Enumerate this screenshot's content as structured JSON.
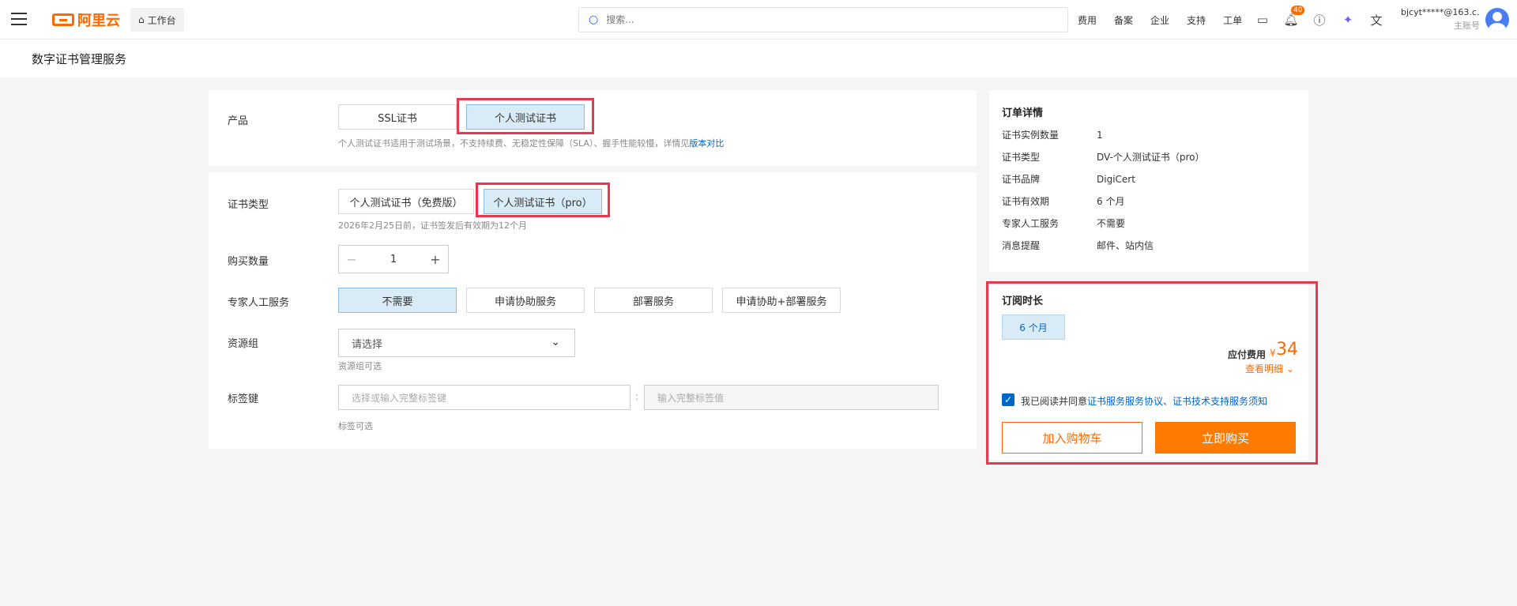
{
  "topbar": {
    "logo_text": "阿里云",
    "workbench": "工作台",
    "search_placeholder": "搜索...",
    "links": [
      "费用",
      "备案",
      "企业",
      "支持",
      "工单"
    ],
    "notification_count": "40",
    "account": "bjcyt*****@163.c...",
    "account_role": "主账号"
  },
  "page_title": "数字证书管理服务",
  "product": {
    "label": "产品",
    "options": [
      "SSL证书",
      "个人测试证书"
    ],
    "hint": "个人测试证书适用于测试场景，不支持续费、无稳定性保障（SLA）、握手性能较慢，详情见",
    "hint_link": "版本对比"
  },
  "config": {
    "cert_type_label": "证书类型",
    "cert_type_options": [
      "个人测试证书（免费版）",
      "个人测试证书（pro）"
    ],
    "cert_type_hint": "2026年2月25日前，证书签发后有效期为12个月",
    "quantity_label": "购买数量",
    "quantity_value": "1",
    "expert_label": "专家人工服务",
    "expert_options": [
      "不需要",
      "申请协助服务",
      "部署服务",
      "申请协助+部署服务"
    ],
    "resource_group_label": "资源组",
    "resource_group_placeholder": "请选择",
    "resource_group_hint": "资源组可选",
    "tag_label": "标签键",
    "tag_key_placeholder": "选择或输入完整标签键",
    "tag_value_placeholder": "输入完整标签值",
    "tag_hint": "标签可选"
  },
  "order_detail": {
    "title": "订单详情",
    "rows": [
      {
        "k": "证书实例数量",
        "v": "1"
      },
      {
        "k": "证书类型",
        "v": "DV-个人测试证书（pro）"
      },
      {
        "k": "证书品牌",
        "v": "DigiCert"
      },
      {
        "k": "证书有效期",
        "v": "6 个月"
      },
      {
        "k": "专家人工服务",
        "v": "不需要"
      },
      {
        "k": "消息提醒",
        "v": "邮件、站内信"
      }
    ]
  },
  "subscription": {
    "title": "订阅时长",
    "duration": "6 个月",
    "price_label": "应付费用",
    "currency": "¥",
    "price": "34",
    "detail_link": "查看明细",
    "agree_prefix": "我已阅读并同意",
    "agree_link": "证书服务服务协议、证书技术支持服务须知",
    "cart_button": "加入购物车",
    "buy_button": "立即购买"
  },
  "colors": {
    "brand": "#ff6a00",
    "link": "#0064c8",
    "highlight": "#e8384f",
    "selected_bg": "#d9ebf7"
  }
}
